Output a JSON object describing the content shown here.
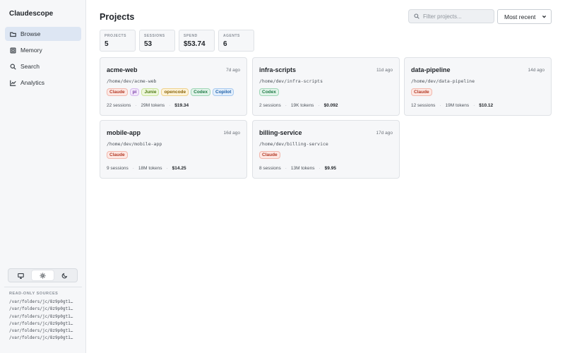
{
  "app": {
    "name": "Claudescope"
  },
  "sidebar": {
    "nav": [
      {
        "label": "Browse",
        "icon": "folder-icon",
        "active": true
      },
      {
        "label": "Memory",
        "icon": "memory-icon",
        "active": false
      },
      {
        "label": "Search",
        "icon": "search-icon",
        "active": false
      },
      {
        "label": "Analytics",
        "icon": "chart-icon",
        "active": false
      }
    ],
    "theme": {
      "options": [
        "monitor-icon",
        "sun-icon",
        "moon-icon"
      ],
      "selected": "sun-icon"
    },
    "sources_title": "READ-ONLY SOURCES",
    "sources": [
      "/var/folders/jc/8z9p0gt1…",
      "/var/folders/jc/8z9p0gt1…",
      "/var/folders/jc/8z9p0gt1…",
      "/var/folders/jc/8z9p0gt1…",
      "/var/folders/jc/8z9p0gt1…",
      "/var/folders/jc/8z9p0gt1…"
    ]
  },
  "header": {
    "title": "Projects",
    "search_placeholder": "Filter projects...",
    "sort_selected": "Most recent"
  },
  "stats": [
    {
      "label": "PROJECTS",
      "value": "5"
    },
    {
      "label": "SESSIONS",
      "value": "53"
    },
    {
      "label": "SPEND",
      "value": "$53.74"
    },
    {
      "label": "AGENTS",
      "value": "6"
    }
  ],
  "tag_colors": {
    "Claude": {
      "bg": "#fde8e4",
      "border": "#f2b8ad",
      "fg": "#b33a26"
    },
    "pi": {
      "bg": "#f3e8fb",
      "border": "#d6b9ee",
      "fg": "#7a3ea8"
    },
    "Junie": {
      "bg": "#eef7dc",
      "border": "#c9e39a",
      "fg": "#4d7a12"
    },
    "opencode": {
      "bg": "#fdf3d9",
      "border": "#eed18c",
      "fg": "#8a6407"
    },
    "Codex": {
      "bg": "#e2f4ea",
      "border": "#9fd6b6",
      "fg": "#1f7a46"
    },
    "Copilot": {
      "bg": "#e3effc",
      "border": "#a7c9ef",
      "fg": "#1d5fa8"
    }
  },
  "projects": [
    {
      "name": "acme-web",
      "age": "7d ago",
      "path": "/home/dev/acme-web",
      "tags": [
        "Claude",
        "pi",
        "Junie",
        "opencode",
        "Codex",
        "Copilot"
      ],
      "sessions": "22 sessions",
      "tokens": "29M tokens",
      "cost": "$19.34"
    },
    {
      "name": "infra-scripts",
      "age": "11d ago",
      "path": "/home/dev/infra-scripts",
      "tags": [
        "Codex"
      ],
      "sessions": "2 sessions",
      "tokens": "19K tokens",
      "cost": "$0.092"
    },
    {
      "name": "data-pipeline",
      "age": "14d ago",
      "path": "/home/dev/data-pipeline",
      "tags": [
        "Claude"
      ],
      "sessions": "12 sessions",
      "tokens": "19M tokens",
      "cost": "$10.12"
    },
    {
      "name": "mobile-app",
      "age": "16d ago",
      "path": "/home/dev/mobile-app",
      "tags": [
        "Claude"
      ],
      "sessions": "9 sessions",
      "tokens": "18M tokens",
      "cost": "$14.25"
    },
    {
      "name": "billing-service",
      "age": "17d ago",
      "path": "/home/dev/billing-service",
      "tags": [
        "Claude"
      ],
      "sessions": "8 sessions",
      "tokens": "13M tokens",
      "cost": "$9.95"
    }
  ]
}
